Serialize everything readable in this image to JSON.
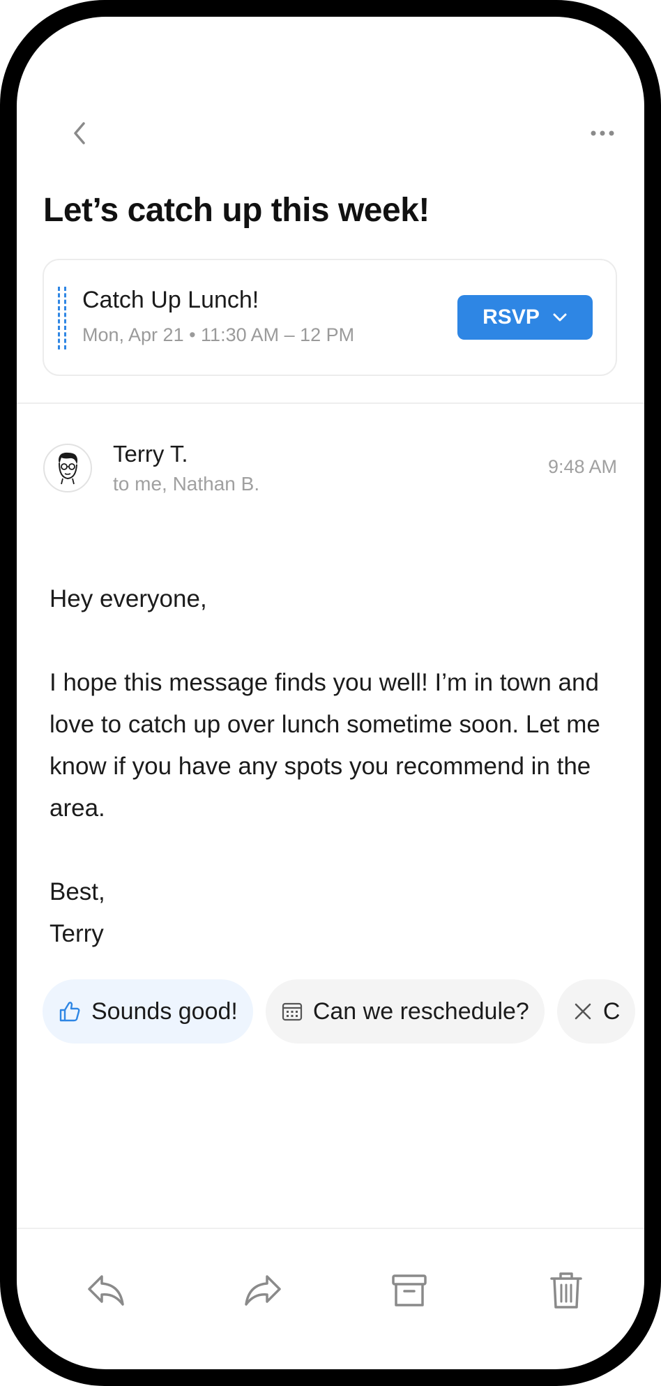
{
  "header": {
    "back_icon": "chevron-left-icon",
    "more_icon": "more-horizontal-icon"
  },
  "email": {
    "subject": "Let’s catch up this week!",
    "sender": "Terry T.",
    "recipients": "to me, Nathan B.",
    "time": "9:48 AM",
    "body": {
      "greeting": "Hey everyone,",
      "paragraph": "I hope this message finds you well! I’m in town and love to catch up over lunch sometime soon. Let me know if you have any spots you recommend in the area.",
      "closing": "Best,",
      "signature": "Terry"
    }
  },
  "event": {
    "title": "Catch Up Lunch!",
    "datetime": "Mon, Apr 21 • 11:30 AM – 12 PM",
    "rsvp_label": "RSVP",
    "accent_color": "#2e86e4"
  },
  "suggestions": [
    {
      "label": "Sounds good!",
      "icon": "thumbs-up-icon"
    },
    {
      "label": "Can we reschedule?",
      "icon": "calendar-icon"
    },
    {
      "label": "C",
      "icon": "close-icon"
    }
  ],
  "toolbar": {
    "reply_icon": "reply-icon",
    "forward_icon": "forward-icon",
    "archive_icon": "archive-icon",
    "delete_icon": "trash-icon"
  }
}
